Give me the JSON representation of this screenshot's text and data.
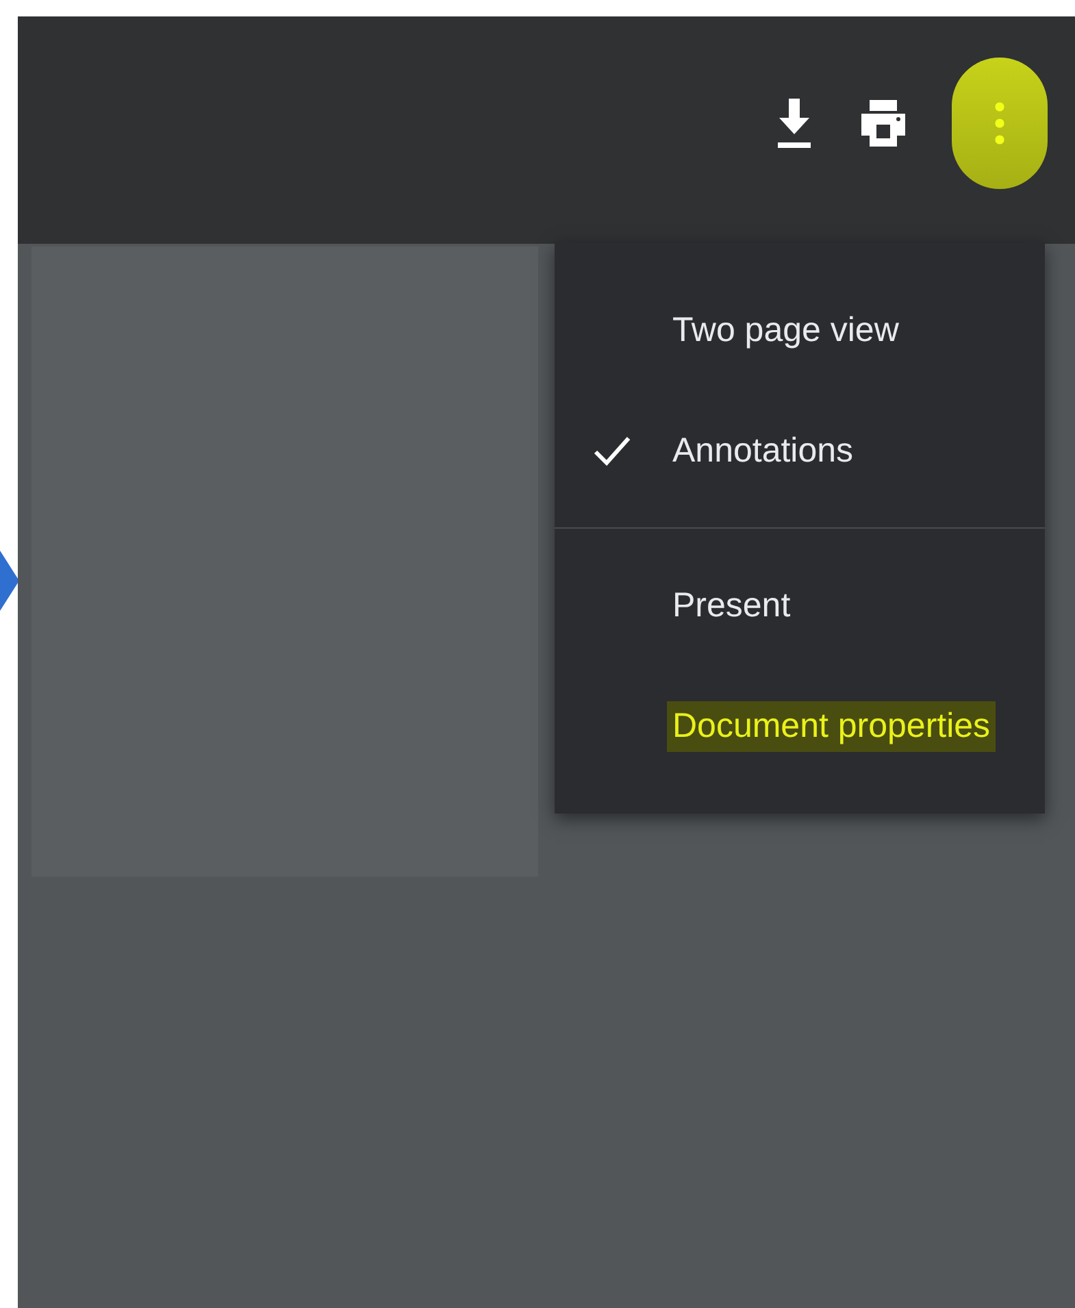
{
  "toolbar": {
    "more_button": {
      "highlighted": true
    }
  },
  "menu": {
    "sections": [
      {
        "items": [
          {
            "label": "Two page view",
            "checked": false,
            "highlighted": false
          },
          {
            "label": "Annotations",
            "checked": true,
            "highlighted": false
          }
        ]
      },
      {
        "items": [
          {
            "label": "Present",
            "checked": false,
            "highlighted": false
          },
          {
            "label": "Document properties",
            "checked": false,
            "highlighted": true
          }
        ]
      }
    ]
  }
}
